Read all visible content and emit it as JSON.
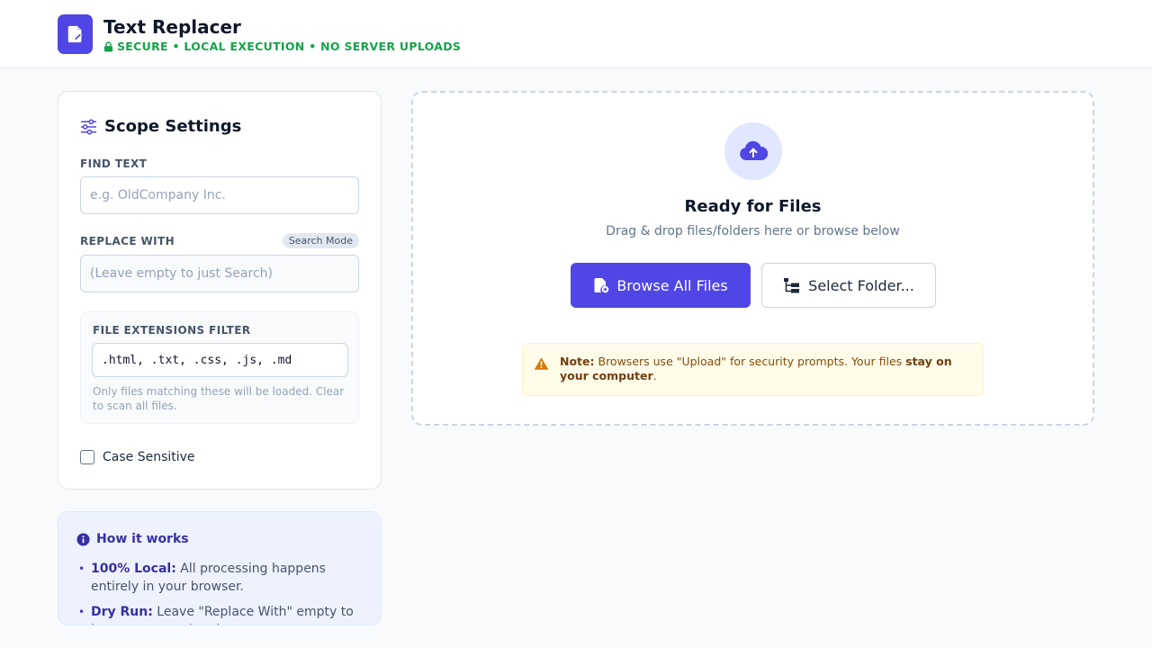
{
  "header": {
    "title": "Text Replacer",
    "security_text": "SECURE • LOCAL EXECUTION • NO SERVER UPLOADS",
    "logo_icon": "file-edit-icon",
    "lock_icon": "lock-icon"
  },
  "settings": {
    "title": "Scope Settings",
    "title_icon": "sliders-icon",
    "find_label": "FIND TEXT",
    "find_placeholder": "e.g. OldCompany Inc.",
    "find_value": "",
    "replace_label": "REPLACE WITH",
    "mode_badge": "Search Mode",
    "replace_placeholder": "(Leave empty to just Search)",
    "replace_value": "",
    "ext_label": "FILE EXTENSIONS FILTER",
    "ext_value": ".html, .txt, .css, .js, .md",
    "ext_help": "Only files matching these will be loaded. Clear to scan all files.",
    "case_label": "Case Sensitive",
    "case_checked": false
  },
  "how": {
    "title": "How it works",
    "items": [
      {
        "strong": "100% Local:",
        "text": "All processing happens entirely in your browser."
      },
      {
        "strong": "Dry Run:",
        "text": "Leave \"Replace With\" empty to just run a search only."
      }
    ]
  },
  "dropzone": {
    "title": "Ready for Files",
    "subtitle": "Drag & drop files/folders here or browse below",
    "browse_label": "Browse All Files",
    "folder_label": "Select Folder...",
    "note_prefix": "Note:",
    "note_text": " Browsers use \"Upload\" for security prompts. Your files ",
    "note_bold": "stay on your computer",
    "note_suffix": "."
  },
  "colors": {
    "accent": "#4f46e5",
    "secure": "#16a34a",
    "warning": "#d97706"
  }
}
